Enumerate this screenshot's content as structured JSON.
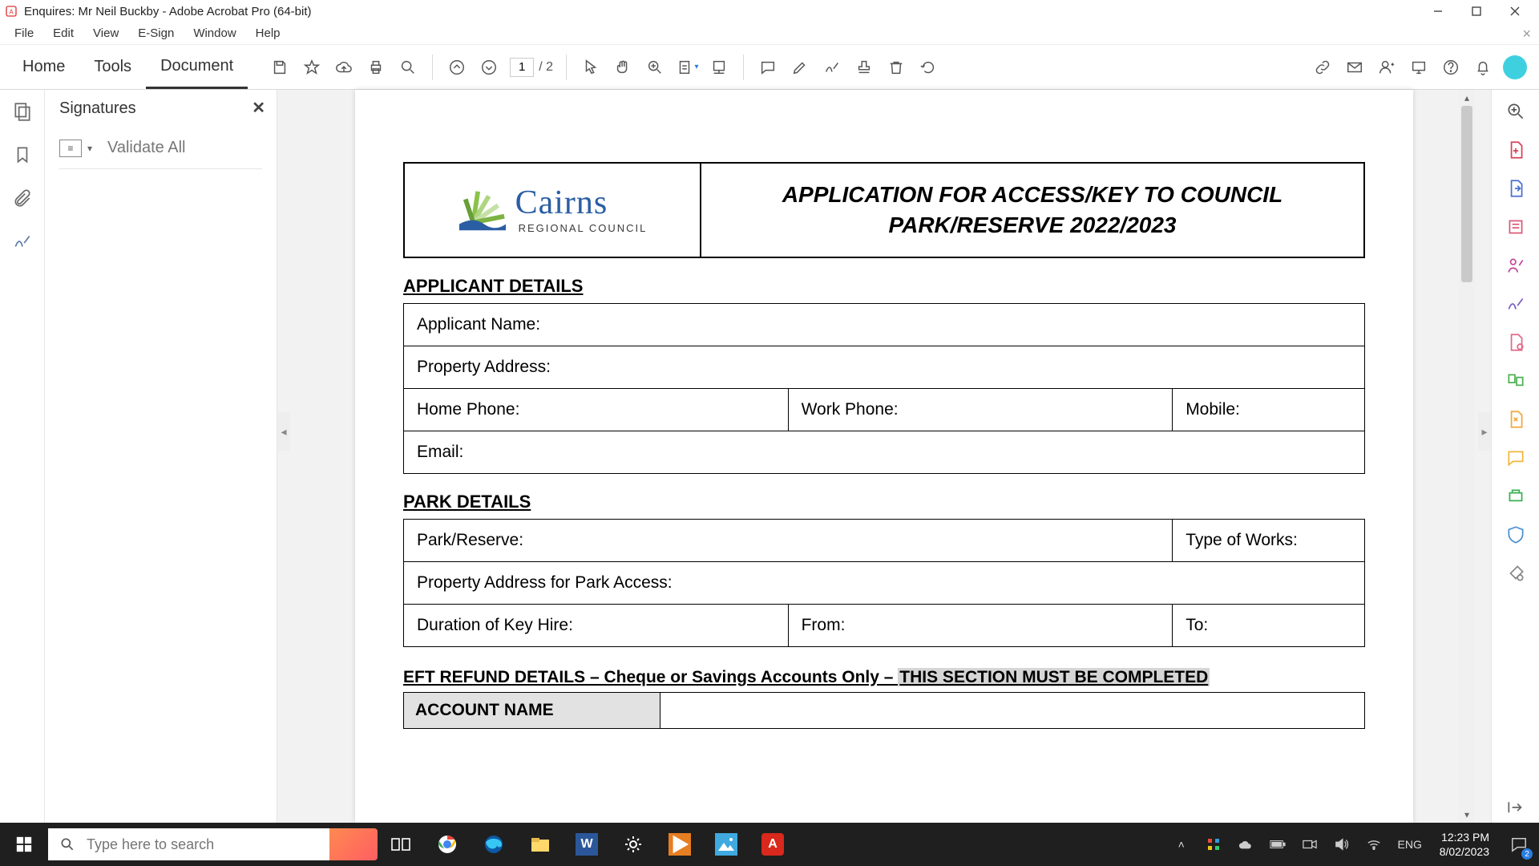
{
  "titlebar": {
    "title": "Enquires: Mr Neil Buckby - Adobe Acrobat Pro (64-bit)"
  },
  "menubar": {
    "items": [
      "File",
      "Edit",
      "View",
      "E-Sign",
      "Window",
      "Help"
    ]
  },
  "maintabs": {
    "home": "Home",
    "tools": "Tools",
    "document": "Document"
  },
  "page": {
    "current": "1",
    "total": "/ 2"
  },
  "sigpanel": {
    "title": "Signatures",
    "validate": "Validate All"
  },
  "doc": {
    "logo_main": "Cairns",
    "logo_sub": "REGIONAL COUNCIL",
    "title_l1": "APPLICATION FOR ACCESS/KEY TO COUNCIL",
    "title_l2": "PARK/RESERVE  2022/2023",
    "sect_applicant": "APPLICANT DETAILS",
    "f_name": "Applicant Name:",
    "f_addr": "Property  Address:",
    "f_home": "Home Phone:",
    "f_work": "Work Phone:",
    "f_mob": "Mobile:",
    "f_email": "Email:",
    "sect_park": "PARK DETAILS",
    "f_park": "Park/Reserve:",
    "f_works": "Type of Works:",
    "f_paddr": "Property Address for Park Access:",
    "f_dur": "Duration of Key Hire:",
    "f_from": "From:",
    "f_to": "To:",
    "eft_a": "EFT REFUND DETAILS – Cheque or Savings Accounts Only – ",
    "eft_b": "THIS SECTION MUST BE COMPLETED",
    "acct": "ACCOUNT NAME"
  },
  "taskbar": {
    "search_placeholder": "Type here to search",
    "lang": "ENG",
    "time": "12:23 PM",
    "date": "8/02/2023",
    "notif_count": "2"
  }
}
